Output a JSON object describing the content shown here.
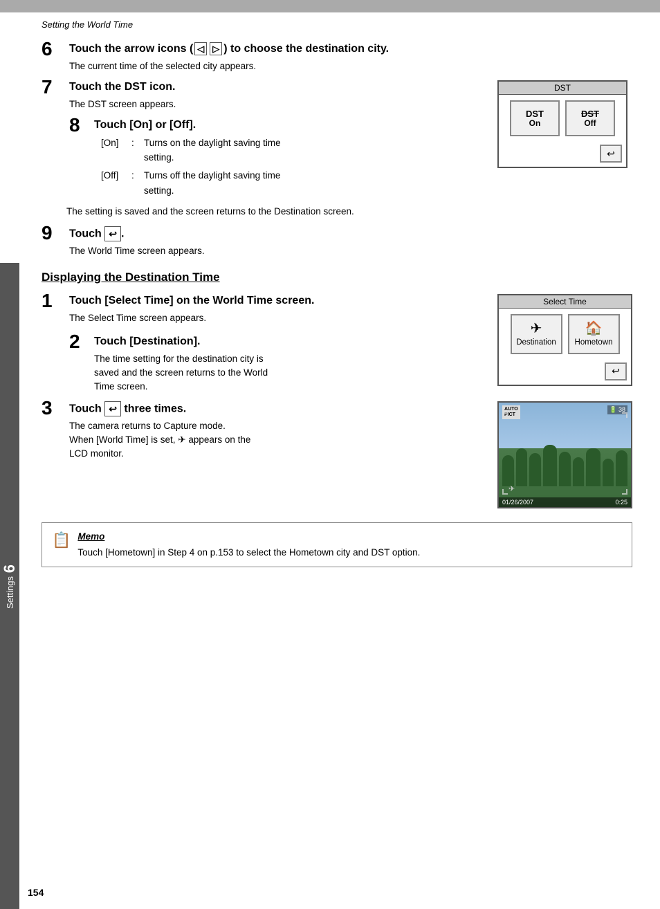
{
  "header": {
    "top_bar_bg": "#aaa",
    "breadcrumb": "Setting the World Time"
  },
  "page_number": "154",
  "sidebar": {
    "number": "6",
    "label": "Settings"
  },
  "steps_part1": [
    {
      "number": "6",
      "title": "Touch the arrow icons (◁ ▷) to choose the destination city.",
      "body": "The current time of the selected city appears.",
      "has_image": false
    },
    {
      "number": "7",
      "title": "Touch the DST icon.",
      "body": "The DST screen appears.",
      "has_image": "dst"
    },
    {
      "number": "8",
      "title": "Touch [On] or [Off].",
      "body_list": [
        {
          "label": "[On]",
          "text": "Turns on the daylight saving time setting."
        },
        {
          "label": "[Off]",
          "text": "Turns off the daylight saving time setting."
        }
      ],
      "footer": "The setting is saved and the screen returns to the Destination screen.",
      "has_image": false
    },
    {
      "number": "9",
      "title": "Touch ↩.",
      "body": "The World Time screen appears.",
      "has_image": false
    }
  ],
  "section_title": "Displaying the Destination Time",
  "steps_part2": [
    {
      "number": "1",
      "title": "Touch [Select Time] on the World Time screen.",
      "body": "The Select Time screen appears.",
      "has_image": "select_time"
    },
    {
      "number": "2",
      "title": "Touch [Destination].",
      "body": "The time setting for the destination city is saved and the screen returns to the World Time screen.",
      "has_image": false
    },
    {
      "number": "3",
      "title": "Touch ↩ three times.",
      "body": "The camera returns to Capture mode.\nWhen [World Time] is set, ✈ appears on the LCD monitor.",
      "has_image": "camera"
    }
  ],
  "dst_screen": {
    "title": "DST",
    "btn_on_label": "On",
    "btn_off_label": "Off",
    "btn_on_icon": "DST",
    "btn_off_icon": "DST̶"
  },
  "select_time_screen": {
    "title": "Select Time",
    "btn_destination": "Destination",
    "btn_hometown": "Hometown"
  },
  "camera_screen": {
    "date": "01/26/2007",
    "time": "0:25",
    "battery": "38",
    "mode": "AUTO\nPICT"
  },
  "memo": {
    "title": "Memo",
    "text": "Touch [Hometown] in Step 4 on p.153 to select the Hometown city and DST option."
  }
}
